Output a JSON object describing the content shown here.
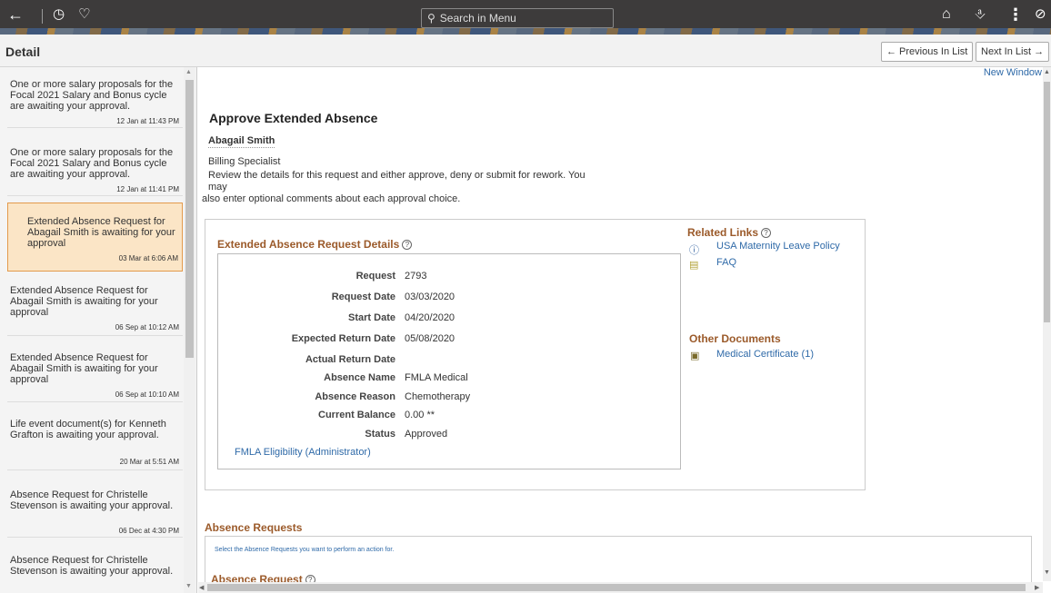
{
  "topbar": {
    "search_placeholder": "Search in Menu",
    "icons": [
      "back-arrow-icon",
      "history-icon",
      "favorites-heart-icon",
      "home-icon",
      "notifications-bell-icon",
      "actions-menu-icon",
      "navbar-compass-icon"
    ]
  },
  "header": {
    "title": "Detail",
    "prev_label": "← Previous In List",
    "next_label": "Next In List →"
  },
  "list": [
    {
      "text": "One or more salary proposals for the Focal 2021 Salary and Bonus cycle are awaiting your approval.",
      "time": "12 Jan at 11:43 PM"
    },
    {
      "text": "One or more salary proposals for the Focal 2021 Salary and Bonus cycle are awaiting your approval.",
      "time": "12 Jan at 11:41 PM"
    },
    {
      "text": "Extended Absence Request for Abagail Smith is awaiting for your approval",
      "time": "03 Mar at 6:06 AM",
      "selected": true
    },
    {
      "text": "Extended Absence Request for Abagail Smith is awaiting for your approval",
      "time": "06 Sep at 10:12 AM"
    },
    {
      "text": "Extended Absence Request for Abagail Smith is awaiting for your approval",
      "time": "06 Sep at 10:10 AM"
    },
    {
      "text": "Life event document(s) for Kenneth Grafton is awaiting your approval.",
      "time": "20 Mar at 5:51 AM"
    },
    {
      "text": "Absence Request for Christelle Stevenson is awaiting your approval.",
      "time": "06 Dec at 4:30 PM"
    },
    {
      "text": "Absence Request for Christelle Stevenson is awaiting your approval.",
      "time": ""
    }
  ],
  "main": {
    "new_window": "New Window",
    "page_title": "Approve Extended Absence",
    "employee_name": "Abagail Smith",
    "employee_title": "Billing Specialist",
    "instructions_line1": "Review the details for this request and either approve, deny or submit for rework. You may",
    "instructions_line2": "also enter optional comments about each approval choice.",
    "details_heading": "Extended Absence Request Details",
    "details": {
      "request_label": "Request",
      "request_value": "2793",
      "request_date_label": "Request Date",
      "request_date_value": "03/03/2020",
      "start_date_label": "Start Date",
      "start_date_value": "04/20/2020",
      "expected_return_label": "Expected Return Date",
      "expected_return_value": "05/08/2020",
      "actual_return_label": "Actual Return Date",
      "actual_return_value": "",
      "absence_name_label": "Absence Name",
      "absence_name_value": "FMLA Medical",
      "absence_reason_label": "Absence Reason",
      "absence_reason_value": "Chemotherapy",
      "current_balance_label": "Current Balance",
      "current_balance_value": "0.00 **",
      "status_label": "Status",
      "status_value": "Approved"
    },
    "fmla_link": "FMLA Eligibility (Administrator)",
    "related_links_heading": "Related Links",
    "related_links": [
      "USA Maternity Leave Policy",
      "FAQ"
    ],
    "other_documents_heading": "Other Documents",
    "other_documents": [
      "Medical Certificate (1)"
    ],
    "absence_requests_heading": "Absence Requests",
    "absence_requests_hint": "Select the Absence Requests you want to perform an action for.",
    "absence_request_subheading": "Absence Request"
  }
}
